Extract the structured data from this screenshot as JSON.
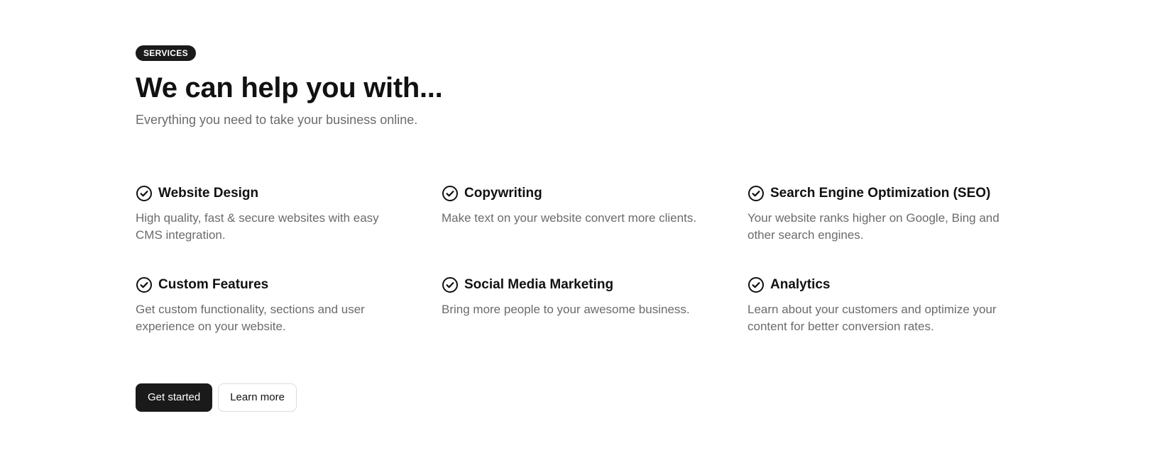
{
  "header": {
    "badge": "SERVICES",
    "title": "We can help you with...",
    "subtitle": "Everything you need to take your business online."
  },
  "features": [
    {
      "title": "Website Design",
      "description": "High quality, fast & secure websites with easy CMS integration.",
      "icon": "check-circle-icon"
    },
    {
      "title": "Copywriting",
      "description": "Make text on your website convert more clients.",
      "icon": "check-circle-icon"
    },
    {
      "title": "Search Engine Optimization (SEO)",
      "description": "Your website ranks higher on Google, Bing and other search engines.",
      "icon": "check-circle-icon"
    },
    {
      "title": "Custom Features",
      "description": "Get custom functionality, sections and user experience on your website.",
      "icon": "check-circle-icon"
    },
    {
      "title": "Social Media Marketing",
      "description": "Bring more people to your awesome business.",
      "icon": "check-circle-icon"
    },
    {
      "title": "Analytics",
      "description": "Learn about your customers and optimize your content for better conversion rates.",
      "icon": "check-circle-icon"
    }
  ],
  "actions": {
    "primary_label": "Get started",
    "secondary_label": "Learn more"
  },
  "colors": {
    "primary": "#1a1a1a",
    "text": "#111111",
    "muted": "#6b6b70",
    "border": "#dcdcdf"
  }
}
